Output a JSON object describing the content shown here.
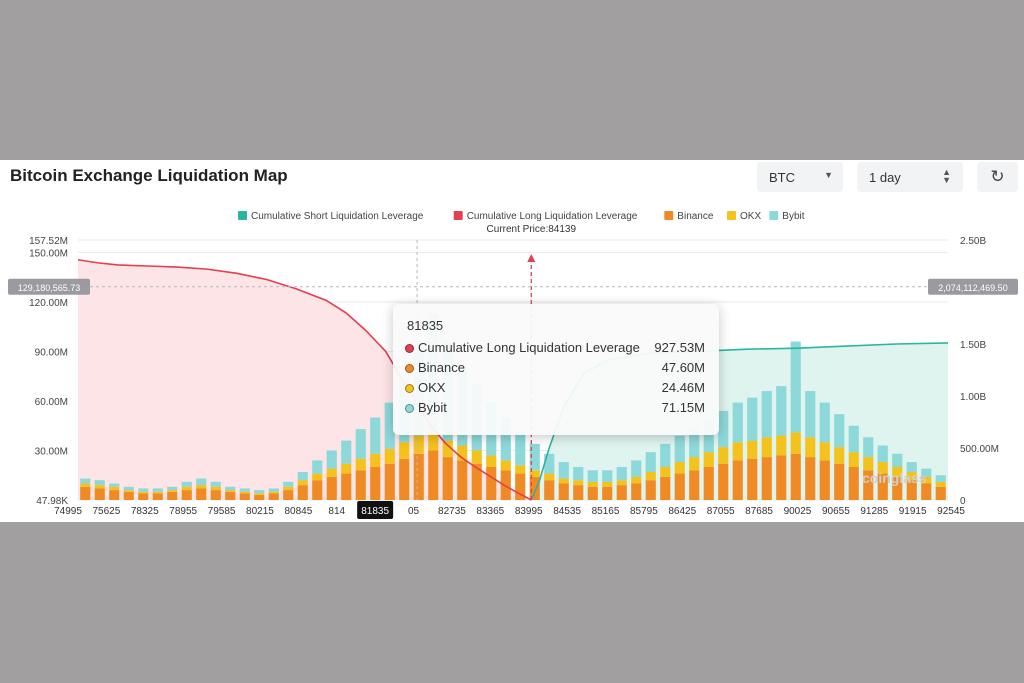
{
  "header": {
    "title": "Bitcoin Exchange Liquidation Map",
    "asset_select": "BTC",
    "range_select": "1 day"
  },
  "icons": {
    "refresh": "refresh-icon",
    "asset_caret": "caret-down-icon",
    "range_caret": "up-down-icon"
  },
  "colors": {
    "short_line": "#2bb5a0",
    "long_line": "#e0404f",
    "binance": "#f08a24",
    "okx": "#f3c21c",
    "bybit": "#8dd8d9",
    "long_fill": "#fde5e7",
    "short_fill": "#dff3ef"
  },
  "tooltip": {
    "title": "81835",
    "rows": [
      {
        "label": "Cumulative Long Liquidation Leverage",
        "value": "927.53M",
        "color": "#e0404f"
      },
      {
        "label": "Binance",
        "value": "47.60M",
        "color": "#f08a24"
      },
      {
        "label": "OKX",
        "value": "24.46M",
        "color": "#f3c21c"
      },
      {
        "label": "Bybit",
        "value": "71.15M",
        "color": "#8dd8d9"
      }
    ]
  },
  "watermark": "coinglass",
  "chart_data": {
    "type": "bar",
    "title": "",
    "current_price_label": "Current Price:84139",
    "current_price": 84139,
    "hover_price": "81835",
    "legend": [
      {
        "name": "Cumulative Short Liquidation Leverage",
        "color": "#2bb5a0"
      },
      {
        "name": "Cumulative Long Liquidation Leverage",
        "color": "#e0404f"
      },
      {
        "name": "Binance",
        "color": "#f08a24"
      },
      {
        "name": "OKX",
        "color": "#f3c21c"
      },
      {
        "name": "Bybit",
        "color": "#8dd8d9"
      }
    ],
    "legend_position": "top-center",
    "x_min": 74995,
    "x_max": 92545,
    "x_ticks": [
      "74995",
      "75625",
      "78325",
      "78955",
      "79585",
      "80215",
      "80845",
      "814",
      "81835",
      "05",
      "82735",
      "83365",
      "83995",
      "84535",
      "85165",
      "85795",
      "86425",
      "87055",
      "87685",
      "90025",
      "90655",
      "91285",
      "91915",
      "92545"
    ],
    "y_left": {
      "ticks": [
        "157.52M",
        "150.00M",
        "120.00M",
        "90.00M",
        "60.00M",
        "30.00M",
        "47.98K"
      ],
      "min": 0,
      "max": 157.52
    },
    "y_right": {
      "ticks": [
        "2.50B",
        "1.50B",
        "1.00B",
        "500.00M",
        "0"
      ],
      "min": 0,
      "max": 2.5
    },
    "crosshair_left_label": "129,180,565.73",
    "crosshair_right_label": "2,074,112,469.50",
    "cumulative_long_B": [
      [
        74995,
        2.31
      ],
      [
        75400,
        2.28
      ],
      [
        75800,
        2.26
      ],
      [
        76400,
        2.25
      ],
      [
        77000,
        2.24
      ],
      [
        77600,
        2.22
      ],
      [
        78200,
        2.18
      ],
      [
        78800,
        2.12
      ],
      [
        79400,
        2.03
      ],
      [
        80000,
        1.92
      ],
      [
        80400,
        1.8
      ],
      [
        80800,
        1.63
      ],
      [
        81200,
        1.43
      ],
      [
        81500,
        1.19
      ],
      [
        81835,
        0.93
      ],
      [
        82100,
        0.72
      ],
      [
        82400,
        0.55
      ],
      [
        82700,
        0.42
      ],
      [
        83000,
        0.32
      ],
      [
        83300,
        0.23
      ],
      [
        83600,
        0.14
      ],
      [
        83900,
        0.06
      ],
      [
        84139,
        0.0
      ]
    ],
    "cumulative_short_B": [
      [
        84139,
        0.0
      ],
      [
        84300,
        0.18
      ],
      [
        84500,
        0.5
      ],
      [
        84800,
        0.9
      ],
      [
        85200,
        1.22
      ],
      [
        85700,
        1.35
      ],
      [
        86500,
        1.41
      ],
      [
        87500,
        1.43
      ],
      [
        88500,
        1.45
      ],
      [
        89500,
        1.46
      ],
      [
        90500,
        1.48
      ],
      [
        91500,
        1.5
      ],
      [
        92545,
        1.51
      ]
    ],
    "series": [
      {
        "name": "Binance",
        "values": [
          8,
          7,
          6,
          5,
          4,
          4,
          5,
          6,
          7,
          6,
          5,
          4,
          3,
          4,
          6,
          9,
          12,
          14,
          16,
          18,
          20,
          22,
          25,
          28,
          30,
          26,
          24,
          22,
          20,
          18,
          16,
          14,
          12,
          10,
          9,
          8,
          8,
          9,
          10,
          12,
          14,
          16,
          18,
          20,
          22,
          24,
          25,
          26,
          27,
          28,
          26,
          24,
          22,
          20,
          18,
          16,
          14,
          12,
          10,
          8
        ]
      },
      {
        "name": "OKX",
        "values": [
          2,
          2,
          2,
          1,
          1,
          1,
          1,
          2,
          2,
          2,
          1,
          1,
          1,
          1,
          2,
          3,
          4,
          5,
          6,
          7,
          8,
          9,
          10,
          11,
          12,
          10,
          9,
          8,
          7,
          6,
          5,
          4,
          4,
          3,
          3,
          3,
          3,
          3,
          4,
          5,
          6,
          7,
          8,
          9,
          10,
          11,
          11,
          12,
          12,
          13,
          12,
          11,
          10,
          9,
          8,
          7,
          6,
          5,
          4,
          3
        ]
      },
      {
        "name": "Bybit",
        "values": [
          3,
          3,
          2,
          2,
          2,
          2,
          2,
          3,
          4,
          3,
          2,
          2,
          2,
          2,
          3,
          5,
          8,
          11,
          14,
          18,
          22,
          28,
          38,
          55,
          71,
          60,
          48,
          40,
          32,
          26,
          20,
          16,
          12,
          10,
          8,
          7,
          7,
          8,
          10,
          12,
          14,
          16,
          18,
          20,
          22,
          24,
          26,
          28,
          30,
          55,
          28,
          24,
          20,
          16,
          12,
          10,
          8,
          6,
          5,
          4
        ]
      }
    ]
  }
}
